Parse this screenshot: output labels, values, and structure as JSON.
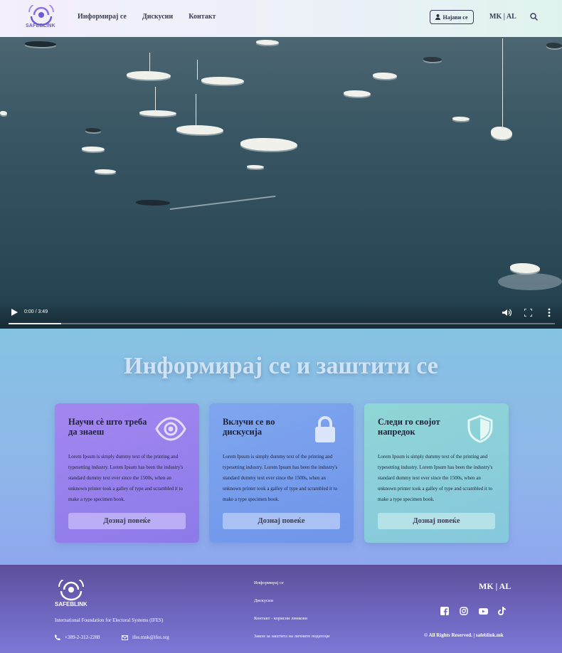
{
  "header": {
    "logo_text": "SAFEBLINK",
    "nav": [
      "Информирај се",
      "Дискусии",
      "Контакт"
    ],
    "login_label": "Најави се",
    "language": "MK | AL"
  },
  "video": {
    "time": "0:00 / 3:49",
    "progress": 0.097
  },
  "main": {
    "title": "Информирај се и заштити се",
    "cards": [
      {
        "title": "Научи сè што треба да знаеш",
        "icon": "eye-icon",
        "text": "Lorem Ipsum is simply dummy text of the printing and typesetting industry. Lorem Ipsum has been the industry's standard dummy text ever since the 1500s, when an unknown printer took a galley of type and scrambled it to make a type specimen book.",
        "button": "Дознај повеќе"
      },
      {
        "title": "Вклучи се во дискусија",
        "icon": "lock-icon",
        "text": "Lorem Ipsum is simply dummy text of the printing and typesetting industry. Lorem Ipsum has been the industry's standard dummy text ever since the 1500s, when an unknown printer took a galley of type and scrambled it to make a type specimen book.",
        "button": "Дознај повеќе"
      },
      {
        "title": "Следи го својот напредок",
        "icon": "shield-icon",
        "text": "Lorem Ipsum is simply dummy text of the printing and typesetting industry. Lorem Ipsum has been the industry's standard dummy text ever since the 1500s, when an unknown printer took a galley of type and scrambled it to make a type specimen book.",
        "button": "Дознај повеќе"
      }
    ]
  },
  "footer": {
    "logo_text": "SAFEBLINK",
    "org": "International Foundation for Electoral Systems (IFES)",
    "phone": "+389-2-312-2288",
    "email": "ifes.mnk@ifes.org",
    "links": [
      "Информирај се",
      "Дискусии",
      "Контакт - корисни линкови",
      "Закон за заштита на личните податоци"
    ],
    "language": "MK | AL",
    "social": [
      "facebook-icon",
      "instagram-icon",
      "youtube-icon",
      "tiktok-icon"
    ],
    "copyright": "© All Rights Reserved. | safeblink.mk"
  }
}
